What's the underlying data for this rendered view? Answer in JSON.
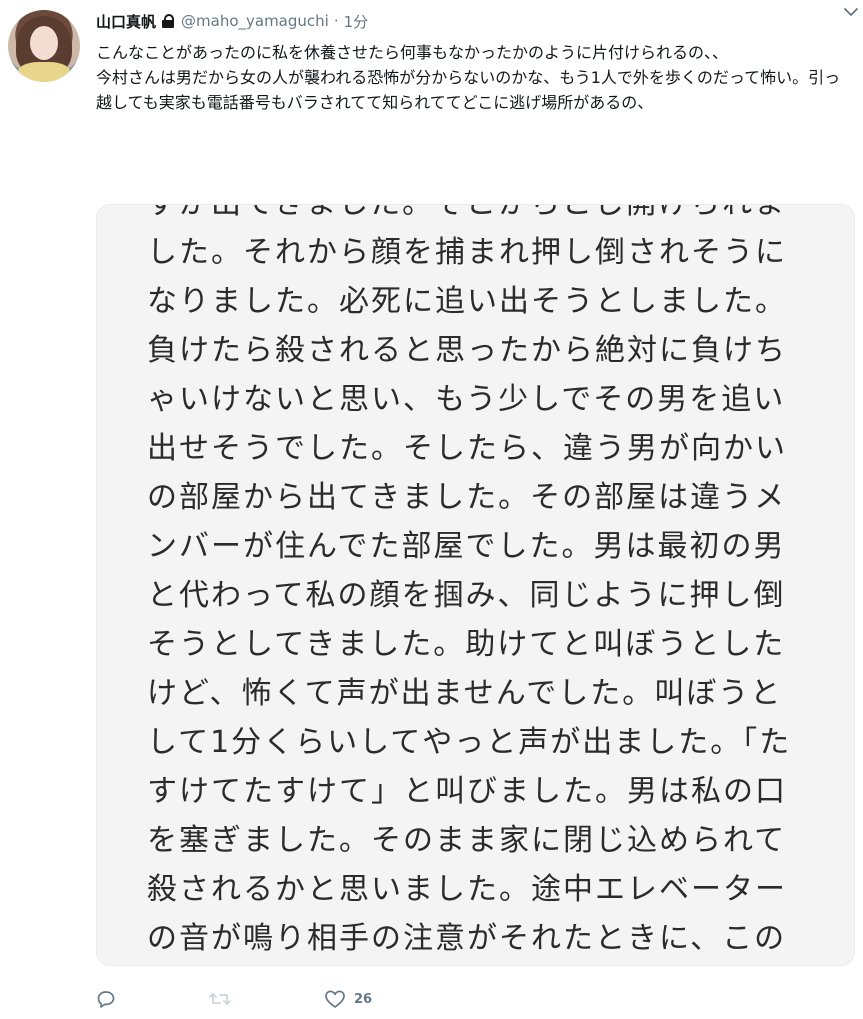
{
  "tweet": {
    "author_name": "山口真帆",
    "handle": "@maho_yamaguchi",
    "separator": "·",
    "time": "1分",
    "text": [
      "こんなことがあったのに私を休養させたら何事もなかったかのように片付けられるの、、",
      "今村さんは男だから女の人が襲われる恐怖が分からないのかな、もう1人で外を歩くのだって怖い。引っ越しても実家も電話番号もバラされてて知られててどこに逃げ場所があるの、"
    ]
  },
  "media": {
    "lines": [
      "ずが出てきました。そこからこじ開けられま",
      "した。それから顔を捕まれ押し倒されそうに",
      "なりました。必死に追い出そうとしました。",
      "負けたら殺されると思ったから絶対に負けち",
      "ゃいけないと思い、もう少しでその男を追い",
      "出せそうでした。そしたら、違う男が向かい",
      "の部屋から出てきました。その部屋は違うメ",
      "ンバーが住んでた部屋でした。男は最初の男",
      "と代わって私の顔を掴み、同じように押し倒",
      "そうとしてきました。助けてと叫ぼうとした",
      "けど、怖くて声が出ませんでした。叫ぼうと",
      "して1分くらいしてやっと声が出ました。「た",
      "すけてたすけて」と叫びました。男は私の口",
      "を塞ぎました。そのまま家に閉じ込められて",
      "殺されるかと思いました。途中エレベーター",
      "の音が鳴り相手の注意がそれたときに、この"
    ]
  },
  "actions": {
    "reply_icon": "reply-icon",
    "retweet_icon": "retweet-icon",
    "like_icon": "heart-icon",
    "like_count": "26"
  },
  "colors": {
    "text": "#14171a",
    "secondary": "#657786",
    "media_bg": "#f4f4f4",
    "retweet_disabled": "#ccd6dd"
  }
}
